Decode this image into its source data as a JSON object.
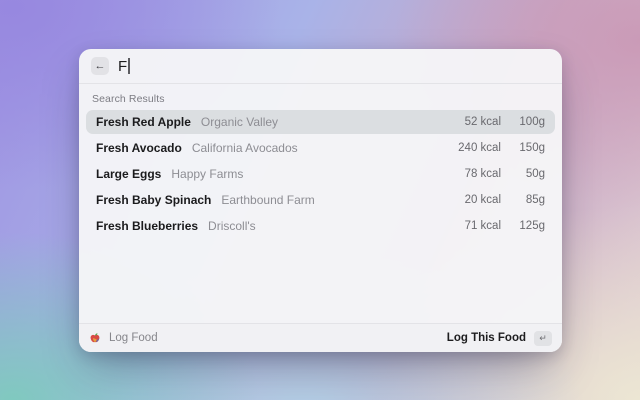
{
  "search": {
    "query": "F",
    "back_icon": "←"
  },
  "section_header": "Search Results",
  "results": [
    {
      "name": "Fresh Red Apple",
      "brand": "Organic Valley",
      "kcal": "52 kcal",
      "weight": "100g",
      "selected": true
    },
    {
      "name": "Fresh Avocado",
      "brand": "California Avocados",
      "kcal": "240 kcal",
      "weight": "150g",
      "selected": false
    },
    {
      "name": "Large Eggs",
      "brand": "Happy Farms",
      "kcal": "78 kcal",
      "weight": "50g",
      "selected": false
    },
    {
      "name": "Fresh Baby Spinach",
      "brand": "Earthbound Farm",
      "kcal": "20 kcal",
      "weight": "85g",
      "selected": false
    },
    {
      "name": "Fresh Blueberries",
      "brand": "Driscoll's",
      "kcal": "71 kcal",
      "weight": "125g",
      "selected": false
    }
  ],
  "footer": {
    "app_name": "Log Food",
    "app_icon": "apple-icon",
    "primary_action": "Log This Food",
    "enter_key_icon": "↵"
  },
  "colors": {
    "panel_bg": "#f5f5f7",
    "selected_row": "#dbdee1",
    "gradient_top_left": "#9788e0",
    "gradient_top_right": "#ca99b6",
    "gradient_bottom_left": "#7ecbbd",
    "gradient_bottom_center": "#b2d3e8",
    "gradient_bottom_right": "#ece6d3"
  }
}
